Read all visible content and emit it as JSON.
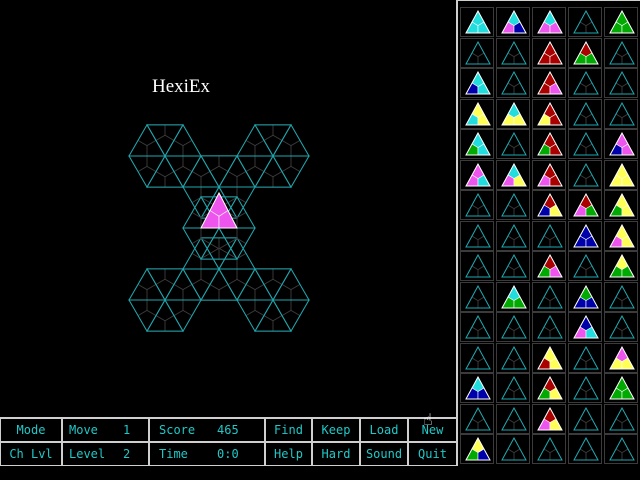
{
  "app": {
    "title": "HexiEx"
  },
  "colors": {
    "grid": "#1ea8b0",
    "wedge_line": "#3a3a3a",
    "text": "#20c8c8",
    "placed_piece": "#ee55ee"
  },
  "status": {
    "mode_label": "Mode",
    "move_label": "Move",
    "move_value": "1",
    "score_label": "Score",
    "score_value": "465",
    "chlvl_label": "Ch Lvl",
    "level_label": "Level",
    "level_value": "2",
    "time_label": "Time",
    "time_value": "0:0"
  },
  "buttons": {
    "find": "Find",
    "keep": "Keep",
    "load": "Load",
    "new": "New",
    "help": "Help",
    "hard": "Hard",
    "sound": "Sound",
    "quit": "Quit"
  },
  "board": {
    "placed_piece": {
      "colors": [
        "#ee55ee",
        "#ee55ee",
        "#ee55ee"
      ]
    }
  },
  "palette": {
    "rows": [
      [
        [
          "#22dddd",
          "#22dddd",
          "#22dddd"
        ],
        [
          "#22dddd",
          "#ee55ee",
          "#0000aa"
        ],
        [
          "#22dddd",
          "#ee55ee",
          "#ee55ee"
        ],
        null,
        [
          "#00aa00",
          "#00aa00",
          "#00aa00"
        ]
      ],
      [
        null,
        null,
        [
          "#aa0000",
          "#aa0000",
          "#aa0000"
        ],
        [
          "#aa0000",
          "#00aa00",
          "#00aa00"
        ],
        null
      ],
      [
        [
          "#22dddd",
          "#0000aa",
          "#22dddd"
        ],
        null,
        [
          "#aa0000",
          "#aa0000",
          "#ee55ee"
        ],
        null,
        null
      ],
      [
        [
          "#ffff55",
          "#22dddd",
          "#ffff55"
        ],
        [
          "#22dddd",
          "#ffff55",
          "#ffff55"
        ],
        [
          "#aa0000",
          "#ffff55",
          "#aa0000"
        ],
        null,
        null
      ],
      [
        [
          "#22dddd",
          "#00aa00",
          "#22dddd"
        ],
        null,
        [
          "#aa0000",
          "#00aa00",
          "#aa0000"
        ],
        null,
        [
          "#ee55ee",
          "#0000aa",
          "#ee55ee"
        ]
      ],
      [
        [
          "#ee55ee",
          "#ee55ee",
          "#22dddd"
        ],
        [
          "#22dddd",
          "#ee55ee",
          "#ffff55"
        ],
        [
          "#aa0000",
          "#ee55ee",
          "#aa0000"
        ],
        null,
        [
          "#ffff55",
          "#ffff55",
          "#ffff55"
        ]
      ],
      [
        null,
        null,
        [
          "#aa0000",
          "#0000aa",
          "#ffff55"
        ],
        [
          "#aa0000",
          "#ee55ee",
          "#00aa00"
        ],
        [
          "#ffff55",
          "#00aa00",
          "#ffff55"
        ]
      ],
      [
        null,
        null,
        null,
        [
          "#0000aa",
          "#0000aa",
          "#0000aa"
        ],
        [
          "#ffff55",
          "#ee55ee",
          "#ffff55"
        ]
      ],
      [
        null,
        null,
        [
          "#aa0000",
          "#00aa00",
          "#ee55ee"
        ],
        null,
        [
          "#ffff55",
          "#00aa00",
          "#00aa00"
        ]
      ],
      [
        null,
        [
          "#22dddd",
          "#00aa00",
          "#00aa00"
        ],
        null,
        [
          "#00aa00",
          "#0000aa",
          "#0000aa"
        ],
        null
      ],
      [
        null,
        null,
        null,
        [
          "#0000aa",
          "#ee55ee",
          "#22dddd"
        ],
        null
      ],
      [
        null,
        null,
        [
          "#ffff55",
          "#aa0000",
          "#ffff55"
        ],
        null,
        [
          "#ee55ee",
          "#ffff55",
          "#ffff55"
        ]
      ],
      [
        [
          "#22dddd",
          "#0000aa",
          "#0000aa"
        ],
        null,
        [
          "#aa0000",
          "#00aa00",
          "#ffff55"
        ],
        null,
        [
          "#00aa00",
          "#00aa00",
          "#00aa00"
        ]
      ],
      [
        null,
        null,
        [
          "#aa0000",
          "#ee55ee",
          "#ffff55"
        ],
        null,
        null
      ],
      [
        [
          "#ffff55",
          "#00aa00",
          "#0000aa"
        ],
        null,
        null,
        null,
        null
      ]
    ]
  }
}
